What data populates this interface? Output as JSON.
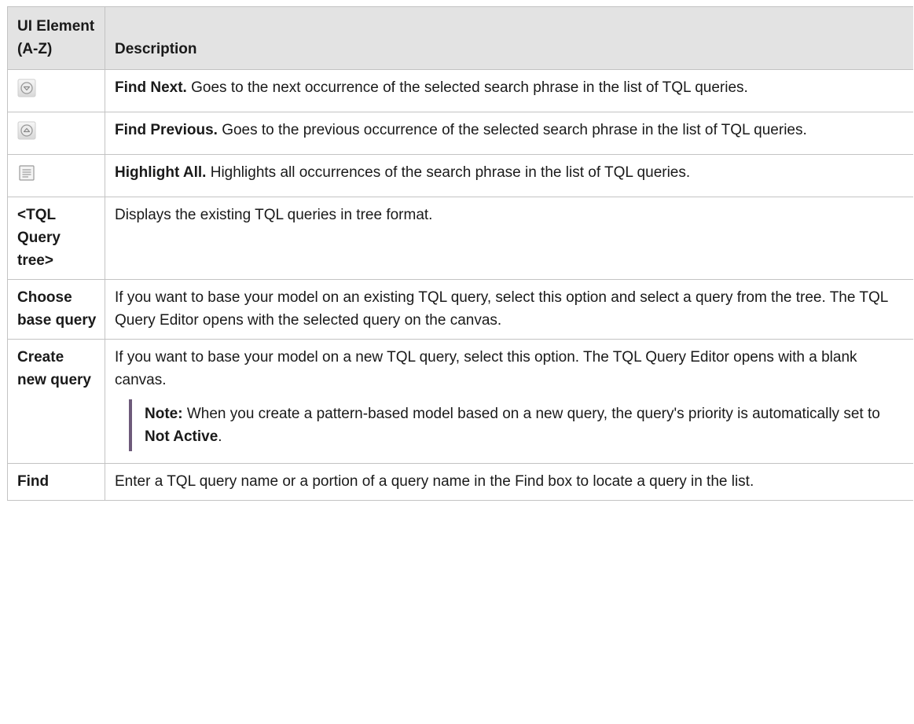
{
  "table": {
    "headers": {
      "element": "UI Element (A-Z)",
      "description": "Description"
    },
    "rows": [
      {
        "icon": "find-next-icon",
        "term": "Find Next.",
        "text": " Goes to the next occurrence of the selected search phrase in the list of TQL queries."
      },
      {
        "icon": "find-previous-icon",
        "term": "Find Previous.",
        "text": " Goes to the previous occurrence of the selected search phrase in the list of TQL queries."
      },
      {
        "icon": "highlight-all-icon",
        "term": "Highlight All.",
        "text": " Highlights all occurrences of the search phrase in the list of TQL queries."
      },
      {
        "element": "<TQL Query tree>",
        "text": "Displays the existing TQL queries in tree format."
      },
      {
        "element": "Choose base query",
        "text": "If you want to base your model on an existing TQL query, select this option and select a query from the tree. The TQL Query Editor opens with the selected query on the canvas."
      },
      {
        "element": "Create new query",
        "text": "If you want to base your model on a new TQL query, select this option. The TQL Query Editor opens with a blank canvas.",
        "note": {
          "label": "Note:",
          "text": " When you create a pattern-based model based on a new query, the query's priority is automatically set to ",
          "bold": "Not Active",
          "end": "."
        }
      },
      {
        "element": "Find",
        "text": "Enter a TQL query name or a portion of a query name in the Find box to locate a query in the list."
      }
    ]
  }
}
